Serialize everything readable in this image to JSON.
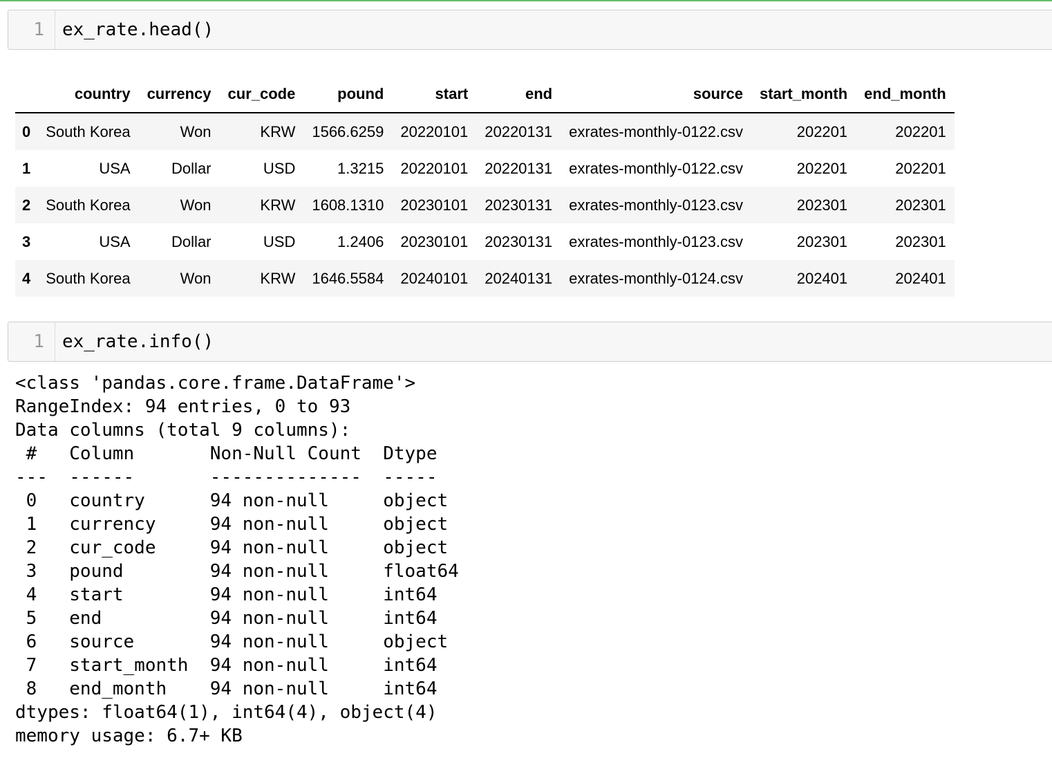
{
  "cell1": {
    "line_number": "1",
    "code": "ex_rate.head()"
  },
  "table": {
    "columns": [
      "",
      "country",
      "currency",
      "cur_code",
      "pound",
      "start",
      "end",
      "source",
      "start_month",
      "end_month"
    ],
    "rows": [
      [
        "0",
        "South Korea",
        "Won",
        "KRW",
        "1566.6259",
        "20220101",
        "20220131",
        "exrates-monthly-0122.csv",
        "202201",
        "202201"
      ],
      [
        "1",
        "USA",
        "Dollar",
        "USD",
        "1.3215",
        "20220101",
        "20220131",
        "exrates-monthly-0122.csv",
        "202201",
        "202201"
      ],
      [
        "2",
        "South Korea",
        "Won",
        "KRW",
        "1608.1310",
        "20230101",
        "20230131",
        "exrates-monthly-0123.csv",
        "202301",
        "202301"
      ],
      [
        "3",
        "USA",
        "Dollar",
        "USD",
        "1.2406",
        "20230101",
        "20230131",
        "exrates-monthly-0123.csv",
        "202301",
        "202301"
      ],
      [
        "4",
        "South Korea",
        "Won",
        "KRW",
        "1646.5584",
        "20240101",
        "20240131",
        "exrates-monthly-0124.csv",
        "202401",
        "202401"
      ]
    ]
  },
  "cell2": {
    "line_number": "1",
    "code": "ex_rate.info()"
  },
  "info_output": [
    "<class 'pandas.core.frame.DataFrame'>",
    "RangeIndex: 94 entries, 0 to 93",
    "Data columns (total 9 columns):",
    " #   Column       Non-Null Count  Dtype  ",
    "---  ------       --------------  -----  ",
    " 0   country      94 non-null     object ",
    " 1   currency     94 non-null     object ",
    " 2   cur_code     94 non-null     object ",
    " 3   pound        94 non-null     float64",
    " 4   start        94 non-null     int64  ",
    " 5   end          94 non-null     int64  ",
    " 6   source       94 non-null     object ",
    " 7   start_month  94 non-null     int64  ",
    " 8   end_month    94 non-null     int64  ",
    "dtypes: float64(1), int64(4), object(4)",
    "memory usage: 6.7+ KB"
  ],
  "colors": {
    "top_border": "#66bb6a",
    "cell_bg": "#f7f7f7",
    "row_stripe": "#f5f5f5"
  }
}
